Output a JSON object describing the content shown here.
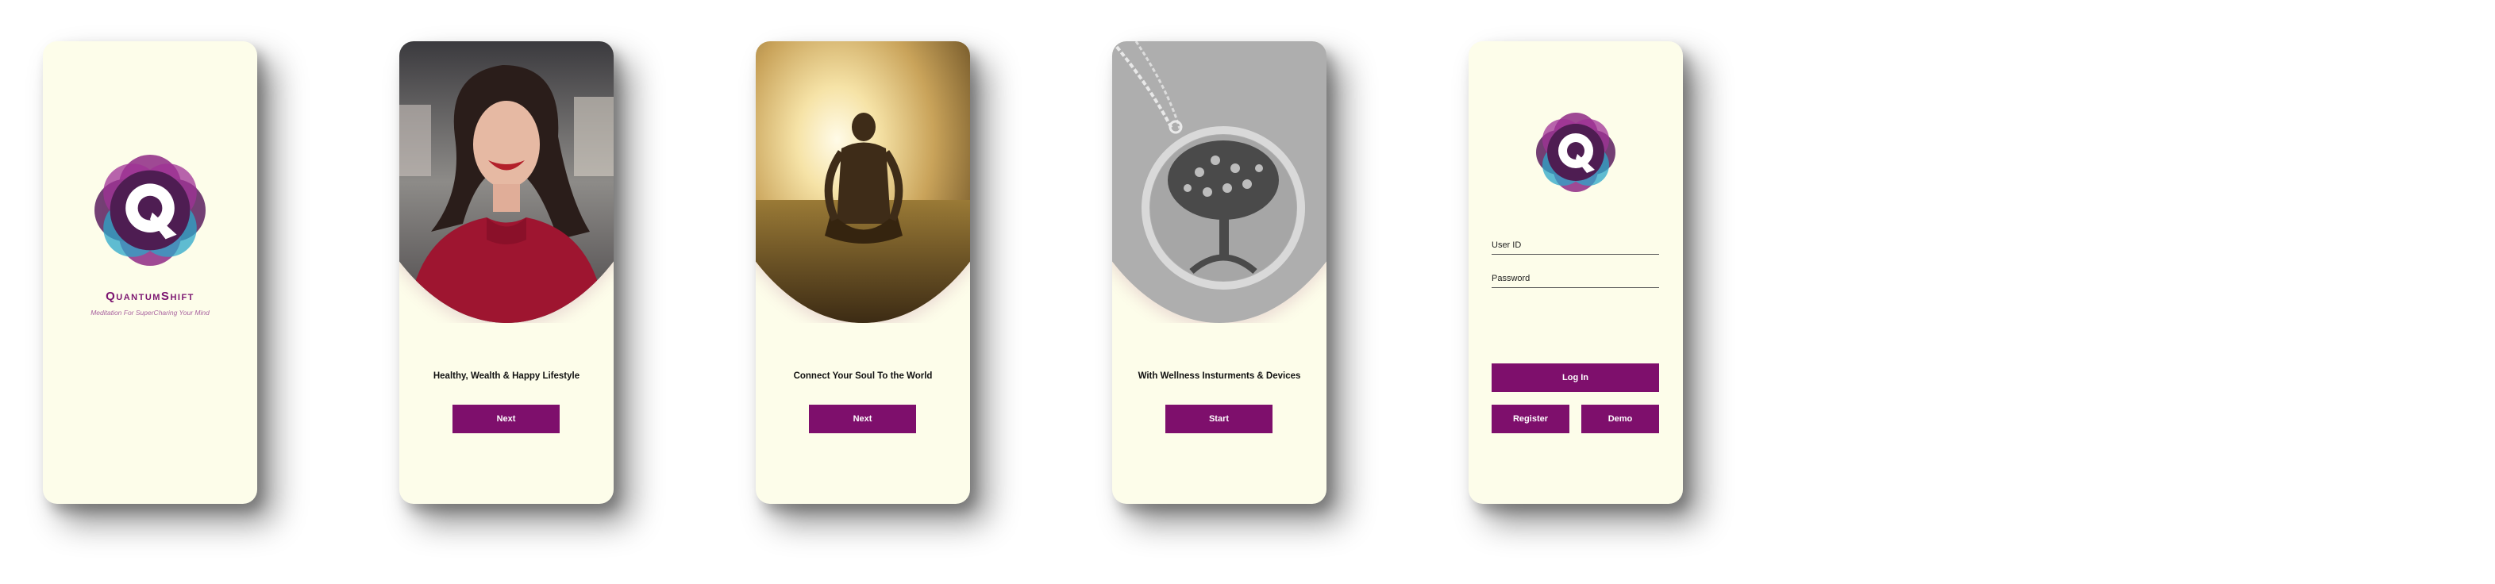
{
  "splash": {
    "brand_name": "QuantumShift",
    "tagline": "Meditation For SuperCharing Your Mind",
    "logo_icon": "quantumshift-logo-icon"
  },
  "onboarding": [
    {
      "image": "smiling-woman-red-sweater-photo",
      "caption": "Healthy, Wealth & Happy Lifestyle",
      "button": "Next"
    },
    {
      "image": "meditating-person-sunset-field-photo",
      "caption": "Connect Your Soul To the World",
      "button": "Next"
    },
    {
      "image": "tree-of-life-pendant-necklace-photo",
      "caption": "With Wellness Insturments & Devices",
      "button": "Start"
    }
  ],
  "login": {
    "user_id_placeholder": "User ID",
    "password_placeholder": "Password",
    "login_button": "Log In",
    "register_button": "Register",
    "demo_button": "Demo"
  },
  "colors": {
    "background": "#fdfdea",
    "primary": "#7e0f6c",
    "logo_purple": "#5b1f5f",
    "logo_magenta": "#9b2a8e",
    "logo_teal": "#2ba7c9"
  }
}
